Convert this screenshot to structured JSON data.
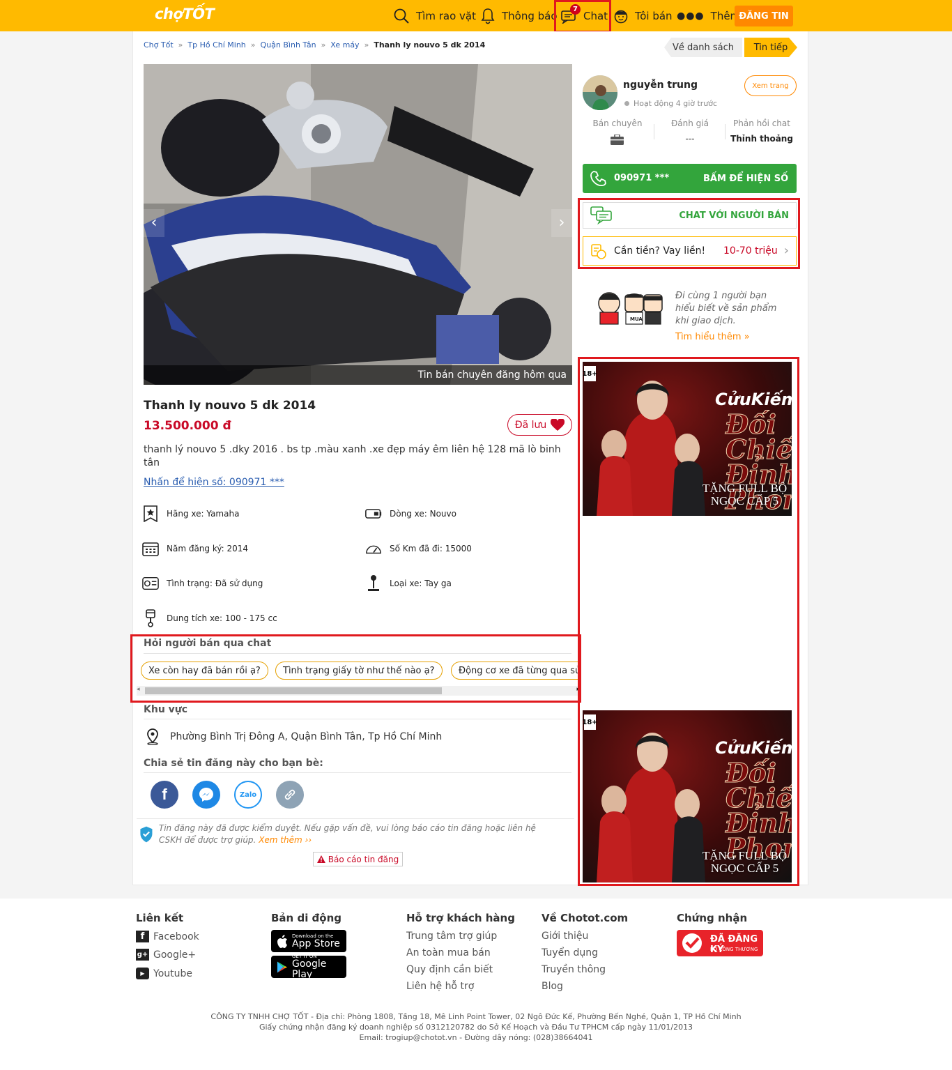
{
  "header": {
    "logo": "chợTỐT",
    "search_label": "Tìm rao vặt",
    "notify_label": "Thông báo",
    "chat_label": "Chat",
    "chat_badge": "7",
    "sell_label": "Tôi bán",
    "more_label": "Thêm",
    "post_label": "ĐĂNG TIN"
  },
  "breadcrumb": [
    "Chợ Tốt",
    "Tp Hồ Chí Minh",
    "Quận Bình Tân",
    "Xe máy"
  ],
  "breadcrumb_current": "Thanh ly nouvo 5 dk 2014",
  "nav": {
    "back_label": "Về danh sách",
    "next_label": "Tin tiếp"
  },
  "photo": {
    "caption": "Tin bán chuyên đăng hôm qua"
  },
  "listing": {
    "title": "Thanh ly nouvo 5 dk 2014",
    "price": "13.500.000 đ",
    "saved_label": "Đã lưu",
    "description": "thanh lý nouvo 5 .dky 2016 . bs tp .màu xanh .xe đẹp máy êm liên hệ 128 mã lò binh tân",
    "phone_link": "Nhấn để hiện số: 090971 ***"
  },
  "attributes": [
    {
      "icon": "brand-star-icon",
      "text": "Hãng xe: Yamaha"
    },
    {
      "icon": "model-tag-icon",
      "text": "Dòng xe: Nouvo"
    },
    {
      "icon": "calendar-icon",
      "text": "Năm đăng ký: 2014"
    },
    {
      "icon": "speedometer-icon",
      "text": "Số Km đã đi: 15000"
    },
    {
      "icon": "condition-card-icon",
      "text": "Tình trạng: Đã sử dụng"
    },
    {
      "icon": "joystick-icon",
      "text": "Loại xe: Tay ga"
    },
    {
      "icon": "piston-icon",
      "text": "Dung tích xe: 100 - 175 cc"
    }
  ],
  "quick_chat": {
    "heading": "Hỏi người bán qua chat",
    "chips": [
      "Xe còn hay đã bán rồi ạ?",
      "Tình trạng giấy tờ như thế nào ạ?",
      "Động cơ xe đã từng qua sửa"
    ]
  },
  "area": {
    "heading": "Khu vực",
    "address": "Phường Bình Trị Đông A, Quận Bình Tân, Tp Hồ Chí Minh"
  },
  "share": {
    "heading": "Chia sẻ tin đăng này cho bạn bè:",
    "zalo": "Zalo"
  },
  "verify": {
    "text": "Tin đăng này đã được kiểm duyệt. Nếu gặp vấn đề, vui lòng báo cáo tin đăng hoặc liên hệ CSKH để được trợ giúp.",
    "more": "Xem thêm ››",
    "report_label": "Báo cáo tin đăng"
  },
  "seller": {
    "name": "nguyễn trung",
    "status": "Hoạt động 4 giờ trước",
    "view_label": "Xem trang",
    "stats": [
      {
        "label": "Bán chuyên",
        "value": ""
      },
      {
        "label": "Đánh giá",
        "value": "---"
      },
      {
        "label": "Phản hồi chat",
        "value": "Thỉnh thoảng"
      }
    ],
    "phone_masked": "090971 ***",
    "phone_hint": "BẤM ĐỂ HIỆN SỐ",
    "chat_label": "CHAT VỚI NGƯỜI BÁN",
    "loan_text": "Cần tiền? Vay liền!",
    "loan_range": "10-70 triệu"
  },
  "guide": {
    "text": "Đi cùng 1 người bạn hiểu biết về sản phẩm khi giao dịch.",
    "link": "Tìm hiểu thêm »",
    "badge": "MUA"
  },
  "ads": [
    {
      "brand": "CửuKiếm",
      "slogan": "Đối Chiến Đỉnh Phong",
      "promo": "TẶNG FULL BỘ NGỌC CẤP 5",
      "rating": "18+"
    },
    {
      "brand": "CửuKiếm",
      "slogan": "Đối Chiến Đỉnh Phong",
      "promo": "TẶNG FULL BỘ NGỌC CẤP 5",
      "rating": "18+"
    }
  ],
  "footer": {
    "col1": {
      "title": "Liên kết",
      "links": [
        "Facebook",
        "Google+",
        "Youtube"
      ]
    },
    "col2": {
      "title": "Bản di động",
      "appstore_small": "Download on the",
      "appstore": "App Store",
      "gplay_small": "GET IT ON",
      "gplay": "Google Play"
    },
    "col3": {
      "title": "Hỗ trợ khách hàng",
      "links": [
        "Trung tâm trợ giúp",
        "An toàn mua bán",
        "Quy định cần biết",
        "Liên hệ hỗ trợ"
      ]
    },
    "col4": {
      "title": "Về Chotot.com",
      "links": [
        "Giới thiệu",
        "Tuyển dụng",
        "Truyền thông",
        "Blog"
      ]
    },
    "col5": {
      "title": "Chứng nhận",
      "cert_big": "ĐÃ ĐĂNG KÝ",
      "cert_small": "BỘ CÔNG THƯƠNG"
    },
    "legal": [
      "CÔNG TY TNHH CHỢ TỐT - Địa chỉ: Phòng 1808, Tầng 18, Mê Linh Point Tower, 02 Ngô Đức Kế, Phường Bến Nghé, Quận 1, TP Hồ Chí Minh",
      "Giấy chứng nhận đăng ký doanh nghiệp số 0312120782 do Sở Kế Hoạch và Đầu Tư TPHCM cấp ngày 11/01/2013",
      "Email: trogiup@chotot.vn - Đường dây nóng: (028)38664041"
    ]
  },
  "colors": {
    "brand": "#ffba00",
    "cta": "#ff8800",
    "price": "#c90927",
    "call": "#33a53c",
    "highlight": "#e0191e"
  }
}
